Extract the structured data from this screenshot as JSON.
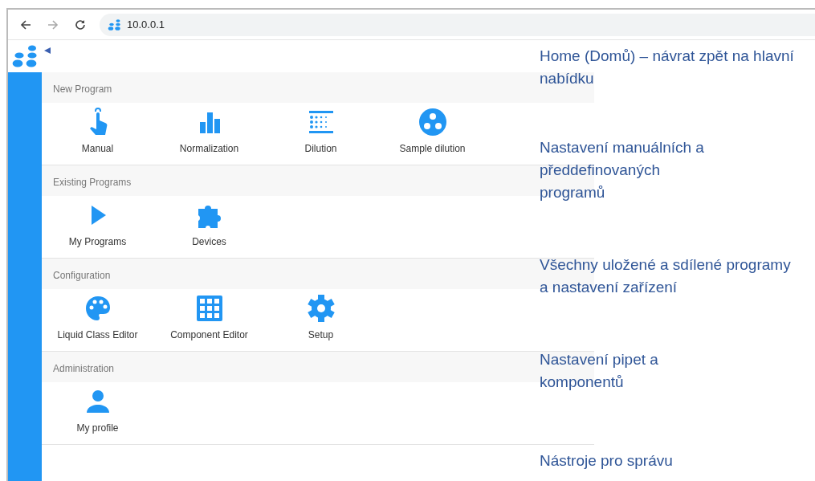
{
  "browser": {
    "url": "10.0.0.1"
  },
  "sections": [
    {
      "title": "New Program",
      "items": [
        {
          "label": "Manual",
          "kind": "touch"
        },
        {
          "label": "Normalization",
          "kind": "bars"
        },
        {
          "label": "Dilution",
          "kind": "dots"
        },
        {
          "label": "Sample dilution",
          "kind": "circle"
        }
      ]
    },
    {
      "title": "Existing Programs",
      "items": [
        {
          "label": "My Programs",
          "kind": "play"
        },
        {
          "label": "Devices",
          "kind": "puzzle"
        }
      ]
    },
    {
      "title": "Configuration",
      "items": [
        {
          "label": "Liquid Class Editor",
          "kind": "palette"
        },
        {
          "label": "Component Editor",
          "kind": "grid"
        },
        {
          "label": "Setup",
          "kind": "gear"
        }
      ]
    },
    {
      "title": "Administration",
      "items": [
        {
          "label": "My profile",
          "kind": "person"
        }
      ]
    }
  ],
  "annotations": [
    "Home (Domů) – návrat zpět na hlavní nabídku",
    "Nastavení manuálních a předdefinovaných programů",
    "Všechny uložené a sdílené programy a nastavení zařízení",
    "Nastavení pipet a komponentů",
    "Nástroje pro správu"
  ]
}
